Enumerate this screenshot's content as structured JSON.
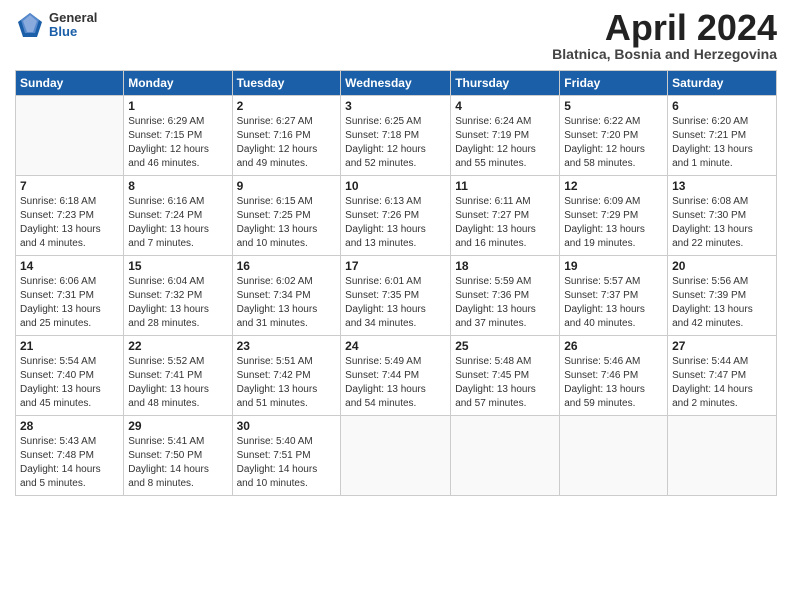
{
  "logo": {
    "general": "General",
    "blue": "Blue"
  },
  "title": "April 2024",
  "location": "Blatnica, Bosnia and Herzegovina",
  "days_header": [
    "Sunday",
    "Monday",
    "Tuesday",
    "Wednesday",
    "Thursday",
    "Friday",
    "Saturday"
  ],
  "weeks": [
    [
      {
        "day": "",
        "info": ""
      },
      {
        "day": "1",
        "info": "Sunrise: 6:29 AM\nSunset: 7:15 PM\nDaylight: 12 hours\nand 46 minutes."
      },
      {
        "day": "2",
        "info": "Sunrise: 6:27 AM\nSunset: 7:16 PM\nDaylight: 12 hours\nand 49 minutes."
      },
      {
        "day": "3",
        "info": "Sunrise: 6:25 AM\nSunset: 7:18 PM\nDaylight: 12 hours\nand 52 minutes."
      },
      {
        "day": "4",
        "info": "Sunrise: 6:24 AM\nSunset: 7:19 PM\nDaylight: 12 hours\nand 55 minutes."
      },
      {
        "day": "5",
        "info": "Sunrise: 6:22 AM\nSunset: 7:20 PM\nDaylight: 12 hours\nand 58 minutes."
      },
      {
        "day": "6",
        "info": "Sunrise: 6:20 AM\nSunset: 7:21 PM\nDaylight: 13 hours\nand 1 minute."
      }
    ],
    [
      {
        "day": "7",
        "info": "Sunrise: 6:18 AM\nSunset: 7:23 PM\nDaylight: 13 hours\nand 4 minutes."
      },
      {
        "day": "8",
        "info": "Sunrise: 6:16 AM\nSunset: 7:24 PM\nDaylight: 13 hours\nand 7 minutes."
      },
      {
        "day": "9",
        "info": "Sunrise: 6:15 AM\nSunset: 7:25 PM\nDaylight: 13 hours\nand 10 minutes."
      },
      {
        "day": "10",
        "info": "Sunrise: 6:13 AM\nSunset: 7:26 PM\nDaylight: 13 hours\nand 13 minutes."
      },
      {
        "day": "11",
        "info": "Sunrise: 6:11 AM\nSunset: 7:27 PM\nDaylight: 13 hours\nand 16 minutes."
      },
      {
        "day": "12",
        "info": "Sunrise: 6:09 AM\nSunset: 7:29 PM\nDaylight: 13 hours\nand 19 minutes."
      },
      {
        "day": "13",
        "info": "Sunrise: 6:08 AM\nSunset: 7:30 PM\nDaylight: 13 hours\nand 22 minutes."
      }
    ],
    [
      {
        "day": "14",
        "info": "Sunrise: 6:06 AM\nSunset: 7:31 PM\nDaylight: 13 hours\nand 25 minutes."
      },
      {
        "day": "15",
        "info": "Sunrise: 6:04 AM\nSunset: 7:32 PM\nDaylight: 13 hours\nand 28 minutes."
      },
      {
        "day": "16",
        "info": "Sunrise: 6:02 AM\nSunset: 7:34 PM\nDaylight: 13 hours\nand 31 minutes."
      },
      {
        "day": "17",
        "info": "Sunrise: 6:01 AM\nSunset: 7:35 PM\nDaylight: 13 hours\nand 34 minutes."
      },
      {
        "day": "18",
        "info": "Sunrise: 5:59 AM\nSunset: 7:36 PM\nDaylight: 13 hours\nand 37 minutes."
      },
      {
        "day": "19",
        "info": "Sunrise: 5:57 AM\nSunset: 7:37 PM\nDaylight: 13 hours\nand 40 minutes."
      },
      {
        "day": "20",
        "info": "Sunrise: 5:56 AM\nSunset: 7:39 PM\nDaylight: 13 hours\nand 42 minutes."
      }
    ],
    [
      {
        "day": "21",
        "info": "Sunrise: 5:54 AM\nSunset: 7:40 PM\nDaylight: 13 hours\nand 45 minutes."
      },
      {
        "day": "22",
        "info": "Sunrise: 5:52 AM\nSunset: 7:41 PM\nDaylight: 13 hours\nand 48 minutes."
      },
      {
        "day": "23",
        "info": "Sunrise: 5:51 AM\nSunset: 7:42 PM\nDaylight: 13 hours\nand 51 minutes."
      },
      {
        "day": "24",
        "info": "Sunrise: 5:49 AM\nSunset: 7:44 PM\nDaylight: 13 hours\nand 54 minutes."
      },
      {
        "day": "25",
        "info": "Sunrise: 5:48 AM\nSunset: 7:45 PM\nDaylight: 13 hours\nand 57 minutes."
      },
      {
        "day": "26",
        "info": "Sunrise: 5:46 AM\nSunset: 7:46 PM\nDaylight: 13 hours\nand 59 minutes."
      },
      {
        "day": "27",
        "info": "Sunrise: 5:44 AM\nSunset: 7:47 PM\nDaylight: 14 hours\nand 2 minutes."
      }
    ],
    [
      {
        "day": "28",
        "info": "Sunrise: 5:43 AM\nSunset: 7:48 PM\nDaylight: 14 hours\nand 5 minutes."
      },
      {
        "day": "29",
        "info": "Sunrise: 5:41 AM\nSunset: 7:50 PM\nDaylight: 14 hours\nand 8 minutes."
      },
      {
        "day": "30",
        "info": "Sunrise: 5:40 AM\nSunset: 7:51 PM\nDaylight: 14 hours\nand 10 minutes."
      },
      {
        "day": "",
        "info": ""
      },
      {
        "day": "",
        "info": ""
      },
      {
        "day": "",
        "info": ""
      },
      {
        "day": "",
        "info": ""
      }
    ]
  ]
}
